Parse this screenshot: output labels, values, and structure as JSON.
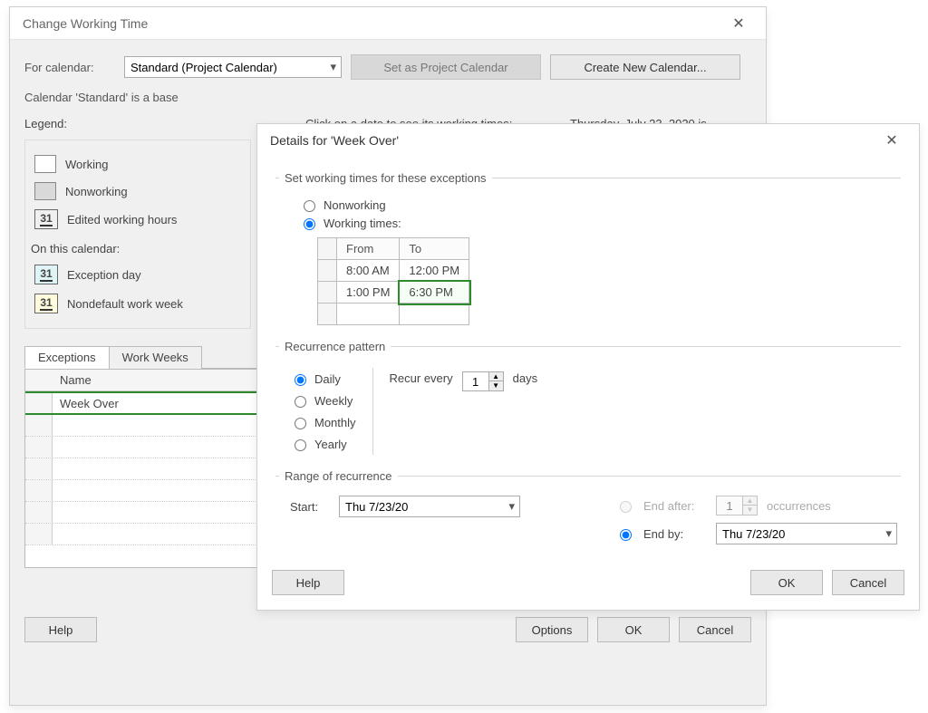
{
  "bgDialog": {
    "title": "Change Working Time",
    "forCalendarLabel": "For calendar:",
    "forCalendarValue": "Standard (Project Calendar)",
    "setAsProjectBtn": "Set as Project Calendar",
    "createNewBtn": "Create New Calendar...",
    "calendarBaseText": "Calendar 'Standard' is a base",
    "legendLabel": "Legend:",
    "legend": {
      "working": "Working",
      "nonworking": "Nonworking",
      "editedHours": "Edited working hours"
    },
    "onThisCalLabel": "On this calendar:",
    "exceptionDay": "Exception day",
    "nondefaultWW": "Nondefault work week",
    "clickText": "Click on a date to see its working times:",
    "dateText": "Thursday, July 23, 2020 is",
    "tabs": {
      "exceptions": "Exceptions",
      "workWeeks": "Work Weeks"
    },
    "gridHeader": "Name",
    "gridRow1": "Week Over",
    "box31": "31",
    "helpBtn": "Help",
    "optionsBtn": "Options",
    "okBtn": "OK",
    "cancelBtn": "Cancel"
  },
  "detailsDialog": {
    "title": "Details for 'Week Over'",
    "setWorkingLabel": "Set working times for these exceptions",
    "radioNonworking": "Nonworking",
    "radioWorking": "Working times:",
    "tblFrom": "From",
    "tblTo": "To",
    "times": [
      {
        "from": "8:00 AM",
        "to": "12:00 PM"
      },
      {
        "from": "1:00 PM",
        "to": "6:30 PM"
      }
    ],
    "recurPatternLabel": "Recurrence pattern",
    "radioDaily": "Daily",
    "radioWeekly": "Weekly",
    "radioMonthly": "Monthly",
    "radioYearly": "Yearly",
    "recurEvery": "Recur every",
    "recurCount": "1",
    "recurUnit": "days",
    "rangeLabel": "Range of recurrence",
    "startLabel": "Start:",
    "startDate": "Thu 7/23/20",
    "endAfterLabel": "End after:",
    "endAfterCount": "1",
    "occurrences": "occurrences",
    "endByLabel": "End by:",
    "endByDate": "Thu 7/23/20",
    "helpBtn": "Help",
    "okBtn": "OK",
    "cancelBtn": "Cancel"
  }
}
